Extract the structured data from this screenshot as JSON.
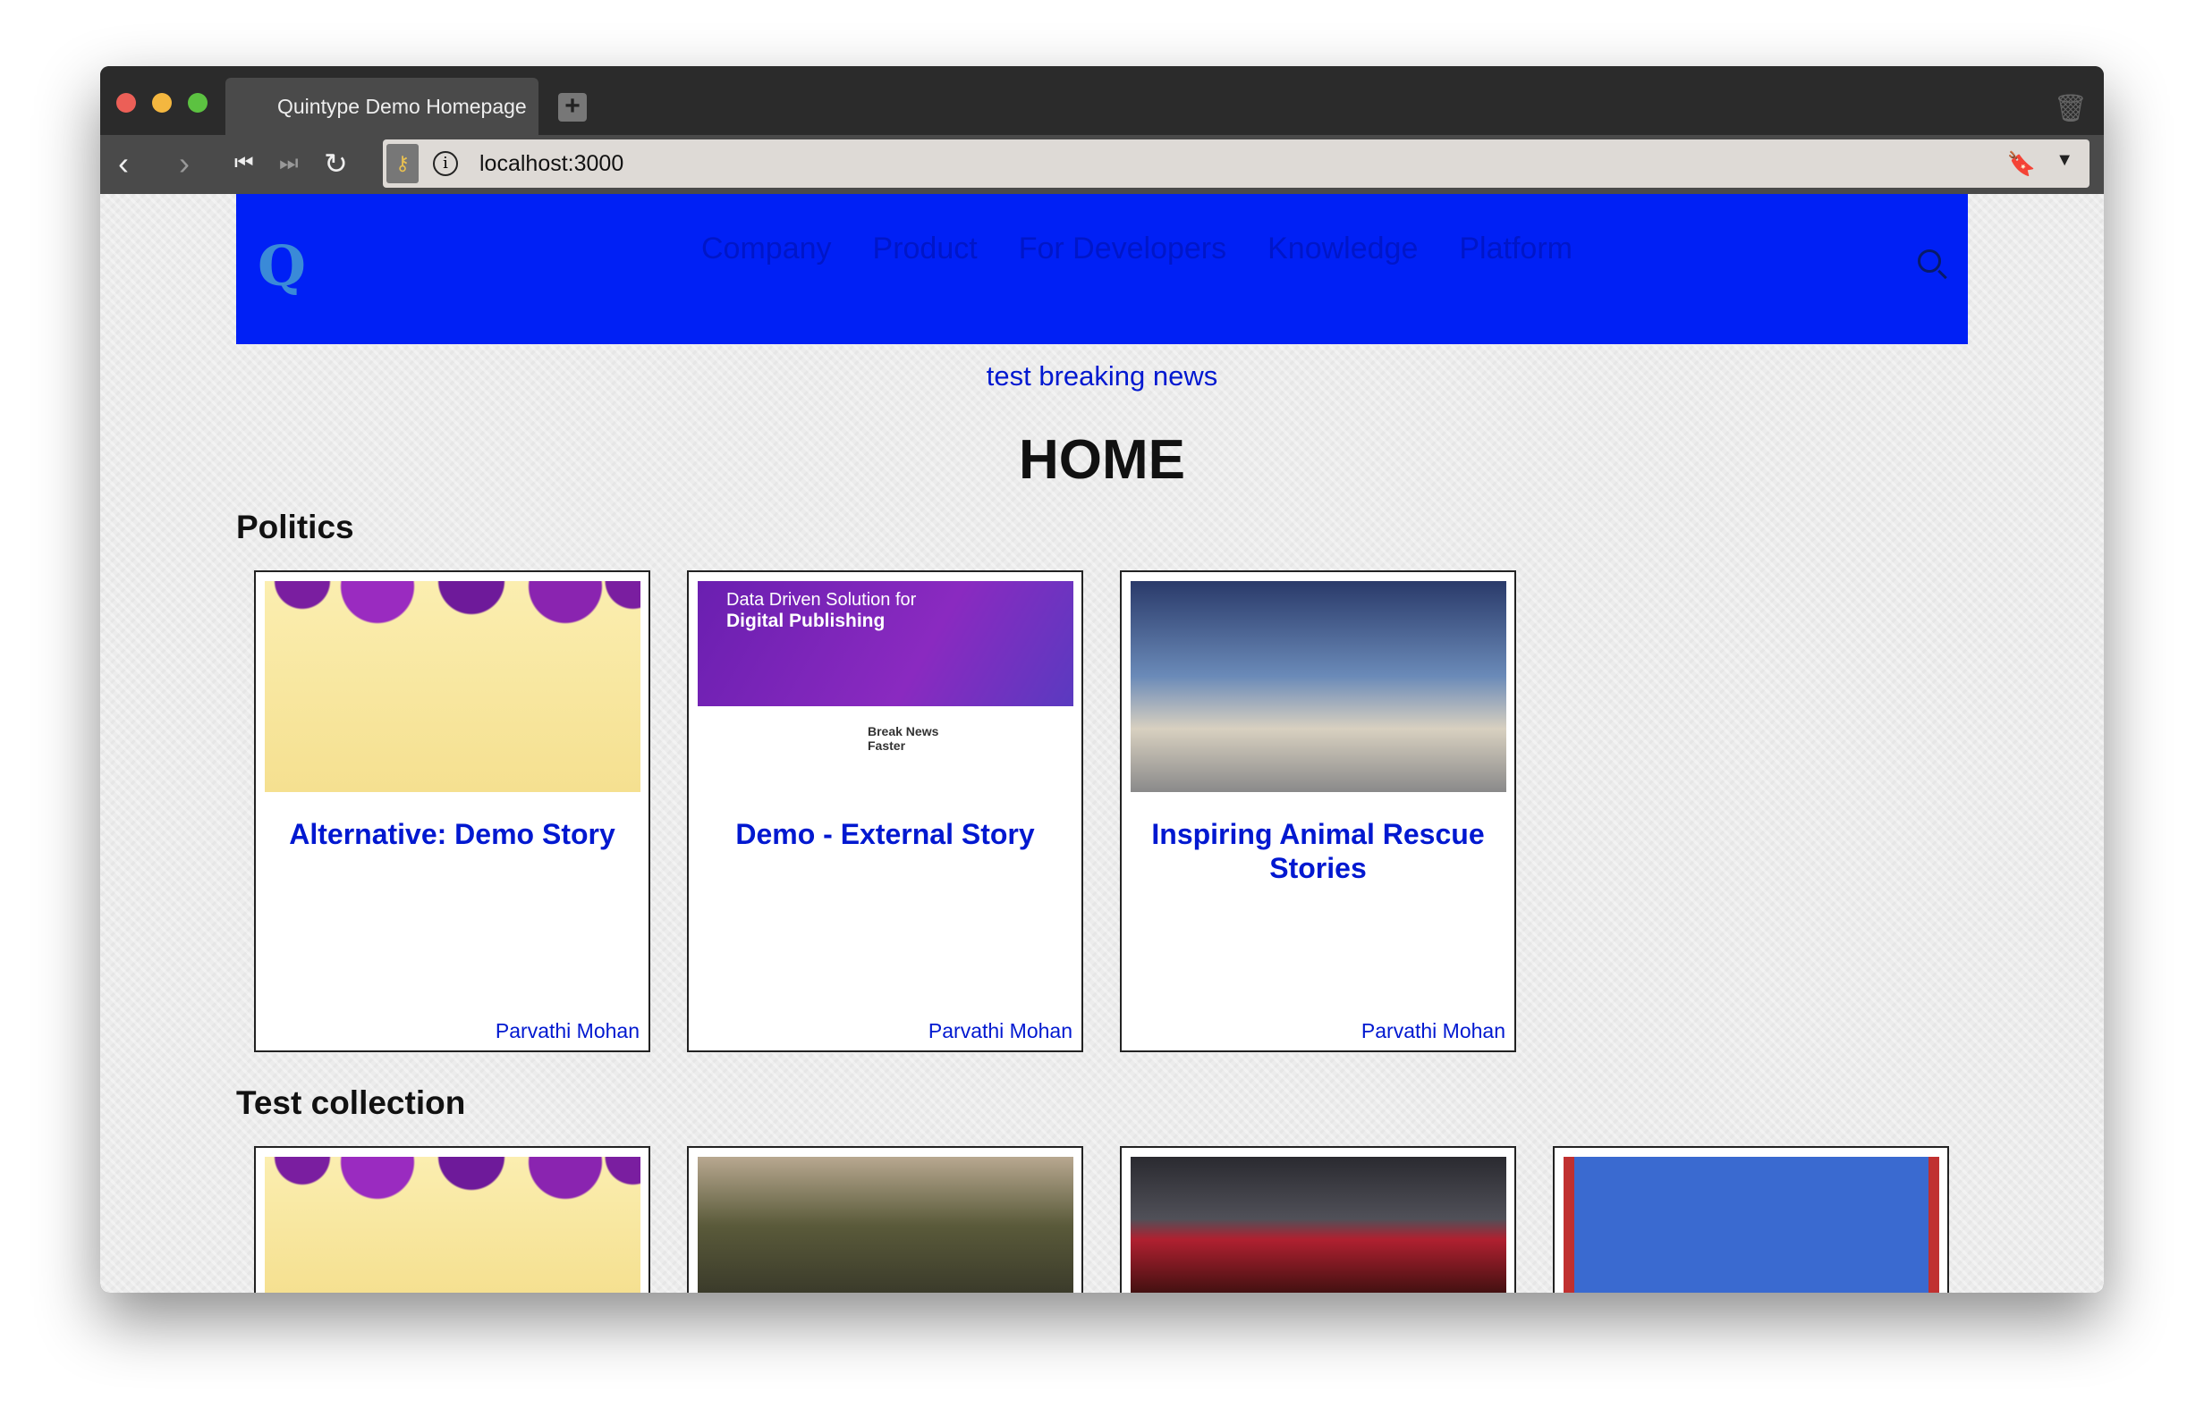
{
  "browser": {
    "tab_title": "Quintype Demo Homepage",
    "url": "localhost:3000"
  },
  "site": {
    "logo_text": "Q",
    "nav": [
      "Company",
      "Product",
      "For Developers",
      "Knowledge",
      "Platform"
    ],
    "breaking_news": "test breaking news",
    "page_title": "HOME",
    "brand_color": "#0020f5"
  },
  "sections": [
    {
      "title": "Politics",
      "stories": [
        {
          "headline": "Alternative: Demo Story",
          "author": "Parvathi Mohan",
          "image": "feathers"
        },
        {
          "headline": "Demo - External Story",
          "author": "Parvathi Mohan",
          "image": "promo",
          "image_text": {
            "line1": "Data Driven Solution for",
            "line2": "Digital Publishing",
            "sub": "Break News Faster"
          }
        },
        {
          "headline": "Inspiring Animal Rescue Stories",
          "author": "Parvathi Mohan",
          "image": "tortoise"
        }
      ]
    },
    {
      "title": "Test collection",
      "stories": [
        {
          "image": "feathers"
        },
        {
          "image": "soldiers"
        },
        {
          "image": "red-car"
        },
        {
          "image": "band"
        }
      ]
    }
  ]
}
